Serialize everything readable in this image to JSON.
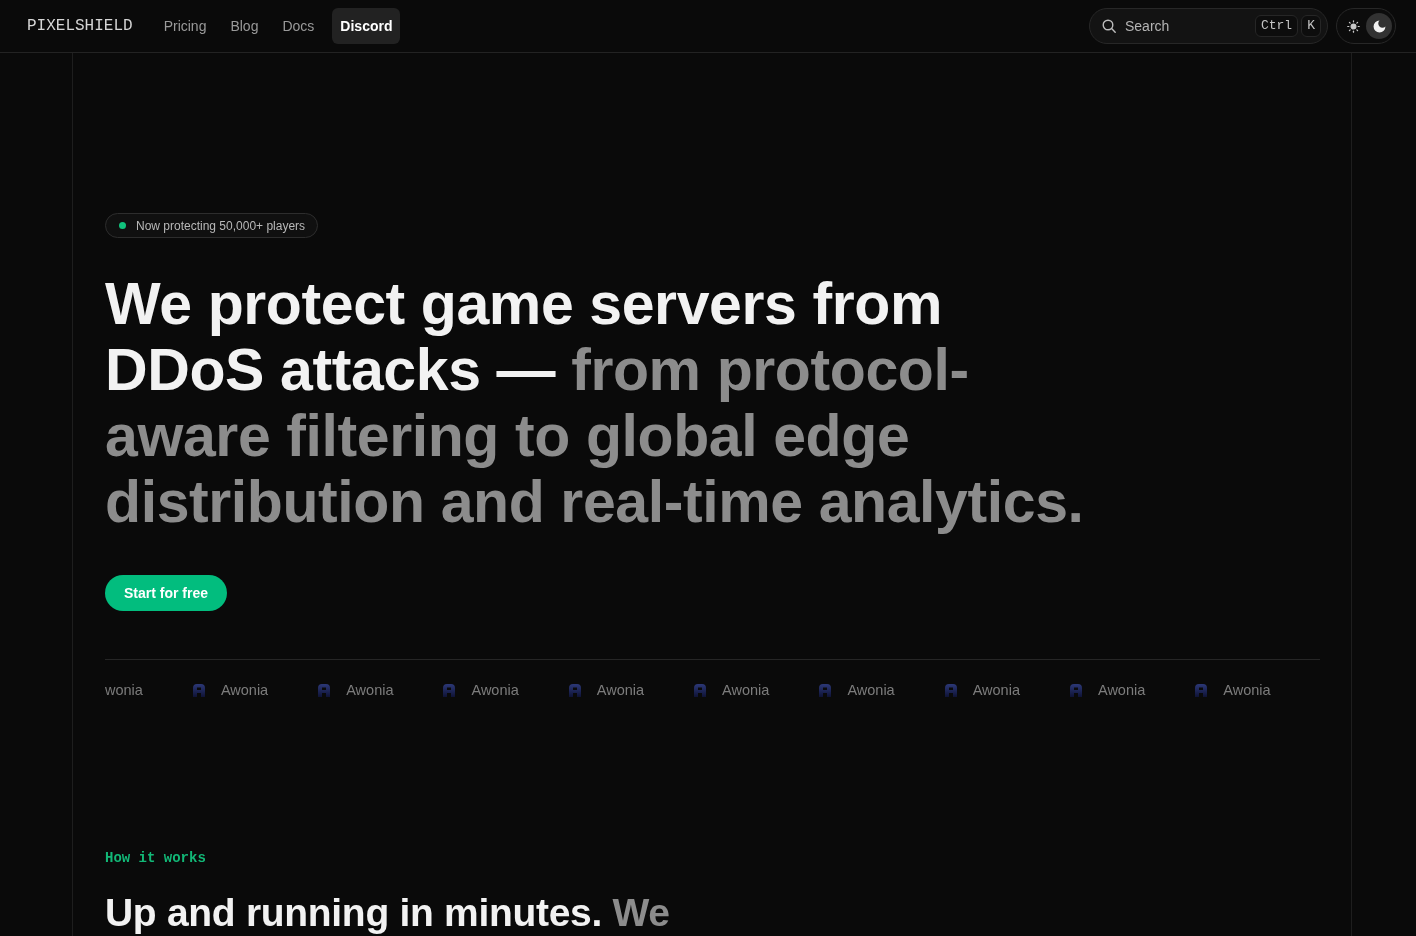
{
  "nav": {
    "logo": "PIXELSHIELD",
    "links": [
      {
        "label": "Pricing",
        "selected": false
      },
      {
        "label": "Blog",
        "selected": false
      },
      {
        "label": "Docs",
        "selected": false
      },
      {
        "label": "Discord",
        "selected": true
      }
    ]
  },
  "search": {
    "label": "Search",
    "shortcut": [
      "Ctrl",
      "K"
    ]
  },
  "theme_toggle": [
    {
      "kind": "sun",
      "selected": false
    },
    {
      "kind": "moon",
      "selected": true
    }
  ],
  "hero": {
    "badge": "Now protecting 50,000+ players",
    "headline": {
      "lead": "We protect game servers from DDoS attacks —",
      "rest": "from protocol-aware filtering to global edge distribution and real-time analytics."
    },
    "cta": "Start for free",
    "logos": [
      {
        "label": "wonia",
        "has_icon": false
      },
      {
        "label": "Awonia",
        "has_icon": true
      },
      {
        "label": "Awonia",
        "has_icon": true
      },
      {
        "label": "Awonia",
        "has_icon": true
      },
      {
        "label": "Awonia",
        "has_icon": true
      },
      {
        "label": "Awonia",
        "has_icon": true
      },
      {
        "label": "Awonia",
        "has_icon": true
      },
      {
        "label": "Awonia",
        "has_icon": true
      },
      {
        "label": "Awonia",
        "has_icon": true
      },
      {
        "label": "Awonia",
        "has_icon": true
      }
    ]
  },
  "how_it_works": {
    "eyebrow": "How it works",
    "heading": {
      "lead": "Up and running in minutes.",
      "rest": "We"
    }
  }
}
